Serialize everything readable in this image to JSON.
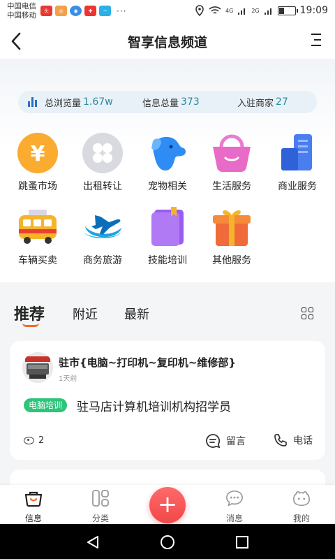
{
  "status_bar": {
    "carrier_1": "中国电信",
    "carrier_2": "中国移动",
    "network_1": "4G",
    "network_2": "2G",
    "time": "19:09",
    "more": "···"
  },
  "header": {
    "title": "智享信息频道",
    "back_icon": "chevron-left-icon",
    "menu_icon": "menu-icon"
  },
  "stats": {
    "views_label": "总浏览量",
    "views_value": "1.67w",
    "total_label": "信息总量",
    "total_value": "373",
    "merchants_label": "入驻商家",
    "merchants_value": "27"
  },
  "categories": [
    {
      "label": "跳蚤市场",
      "icon": "yuan-coin-icon",
      "color": "#f7a020"
    },
    {
      "label": "出租转让",
      "icon": "grid-four-icon",
      "color": "#d8dadf"
    },
    {
      "label": "宠物相关",
      "icon": "dog-icon",
      "color": "#2f8cf5"
    },
    {
      "label": "生活服务",
      "icon": "basket-icon",
      "color": "#e86bc8"
    },
    {
      "label": "商业服务",
      "icon": "building-icon",
      "color": "#4a7ef0"
    },
    {
      "label": "车辆买卖",
      "icon": "bus-icon",
      "color": "#f5b52b"
    },
    {
      "label": "商务旅游",
      "icon": "airplane-icon",
      "color": "#1fa3e0"
    },
    {
      "label": "技能培训",
      "icon": "book-icon",
      "color": "#9a5cf0"
    },
    {
      "label": "其他服务",
      "icon": "gift-icon",
      "color": "#f06a3a"
    }
  ],
  "tabs": {
    "recommend": "推荐",
    "nearby": "附近",
    "latest": "最新"
  },
  "post": {
    "shop_name": "驻市{电脑~打印机~复印机~维修部}",
    "time": "1天前",
    "tag": "电脑培训",
    "text": "驻马店计算机培训机构招学员",
    "views": "2",
    "comment_label": "留言",
    "phone_label": "电话"
  },
  "tabbar": {
    "info": "信息",
    "category": "分类",
    "add": "+",
    "messages": "消息",
    "mine": "我的"
  },
  "colors": {
    "accent": "#f26a2e",
    "stat_value": "#2b8a9b",
    "tag_green": "#2ec47a",
    "fab_red": "#f04848"
  }
}
